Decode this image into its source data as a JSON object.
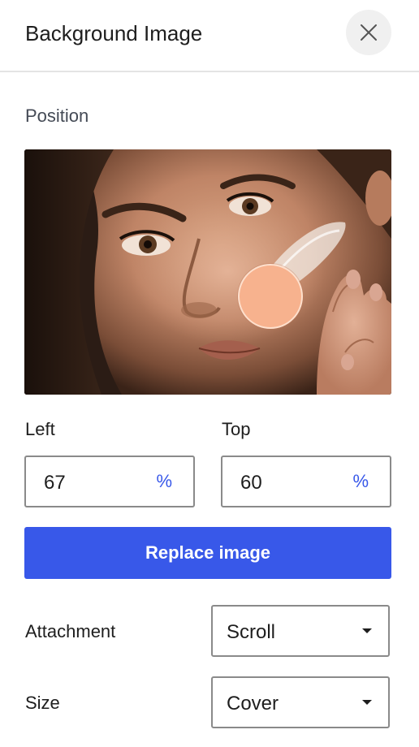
{
  "header": {
    "title": "Background Image",
    "close_icon": "close-icon"
  },
  "position": {
    "label": "Position",
    "focal_point": {
      "left_percent": 67,
      "top_percent": 60
    },
    "handle_color": "#f7b28e"
  },
  "left": {
    "label": "Left",
    "value": "67",
    "unit": "%"
  },
  "top": {
    "label": "Top",
    "value": "60",
    "unit": "%"
  },
  "replace_button": {
    "label": "Replace image",
    "color": "#3858e9"
  },
  "attachment": {
    "label": "Attachment",
    "value": "Scroll"
  },
  "size": {
    "label": "Size",
    "value": "Cover"
  },
  "colors": {
    "accent": "#3858e9",
    "text": "#1e1e1e",
    "muted_label": "#444a55"
  }
}
